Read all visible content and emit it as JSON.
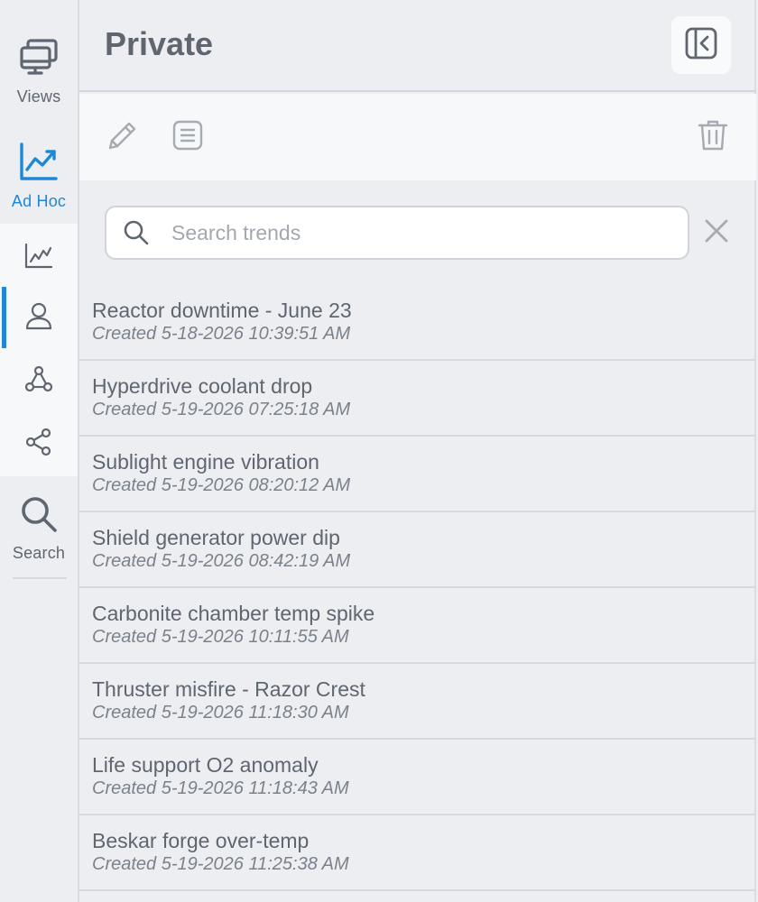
{
  "rail": {
    "views_label": "Views",
    "adhoc_label": "Ad Hoc",
    "search_label": "Search",
    "sub_items": [
      {
        "icon": "trend-chart-icon",
        "active": false
      },
      {
        "icon": "user-icon",
        "active": true
      },
      {
        "icon": "group-icon",
        "active": false
      },
      {
        "icon": "share-icon",
        "active": false
      }
    ]
  },
  "header": {
    "title": "Private"
  },
  "toolbar": {
    "icons": [
      "pencil-icon",
      "document-icon",
      "trash-icon"
    ]
  },
  "search": {
    "placeholder": "Search trends",
    "value": ""
  },
  "trends": [
    {
      "name": "Reactor downtime - June 23",
      "created": "Created 5-18-2026 10:39:51 AM"
    },
    {
      "name": "Hyperdrive coolant drop",
      "created": "Created 5-19-2026 07:25:18 AM"
    },
    {
      "name": "Sublight engine vibration",
      "created": "Created 5-19-2026 08:20:12 AM"
    },
    {
      "name": "Shield generator power dip",
      "created": "Created 5-19-2026 08:42:19 AM"
    },
    {
      "name": "Carbonite chamber temp spike",
      "created": "Created 5-19-2026 10:11:55 AM"
    },
    {
      "name": "Thruster misfire - Razor Crest",
      "created": "Created 5-19-2026 11:18:30 AM"
    },
    {
      "name": "Life support O2 anomaly",
      "created": "Created 5-19-2026 11:18:43 AM"
    },
    {
      "name": "Beskar forge over-temp",
      "created": "Created 5-19-2026 11:25:38 AM"
    }
  ],
  "colors": {
    "accent": "#1e88d6",
    "text": "#5f6670",
    "icon_muted": "#a6abb2"
  }
}
